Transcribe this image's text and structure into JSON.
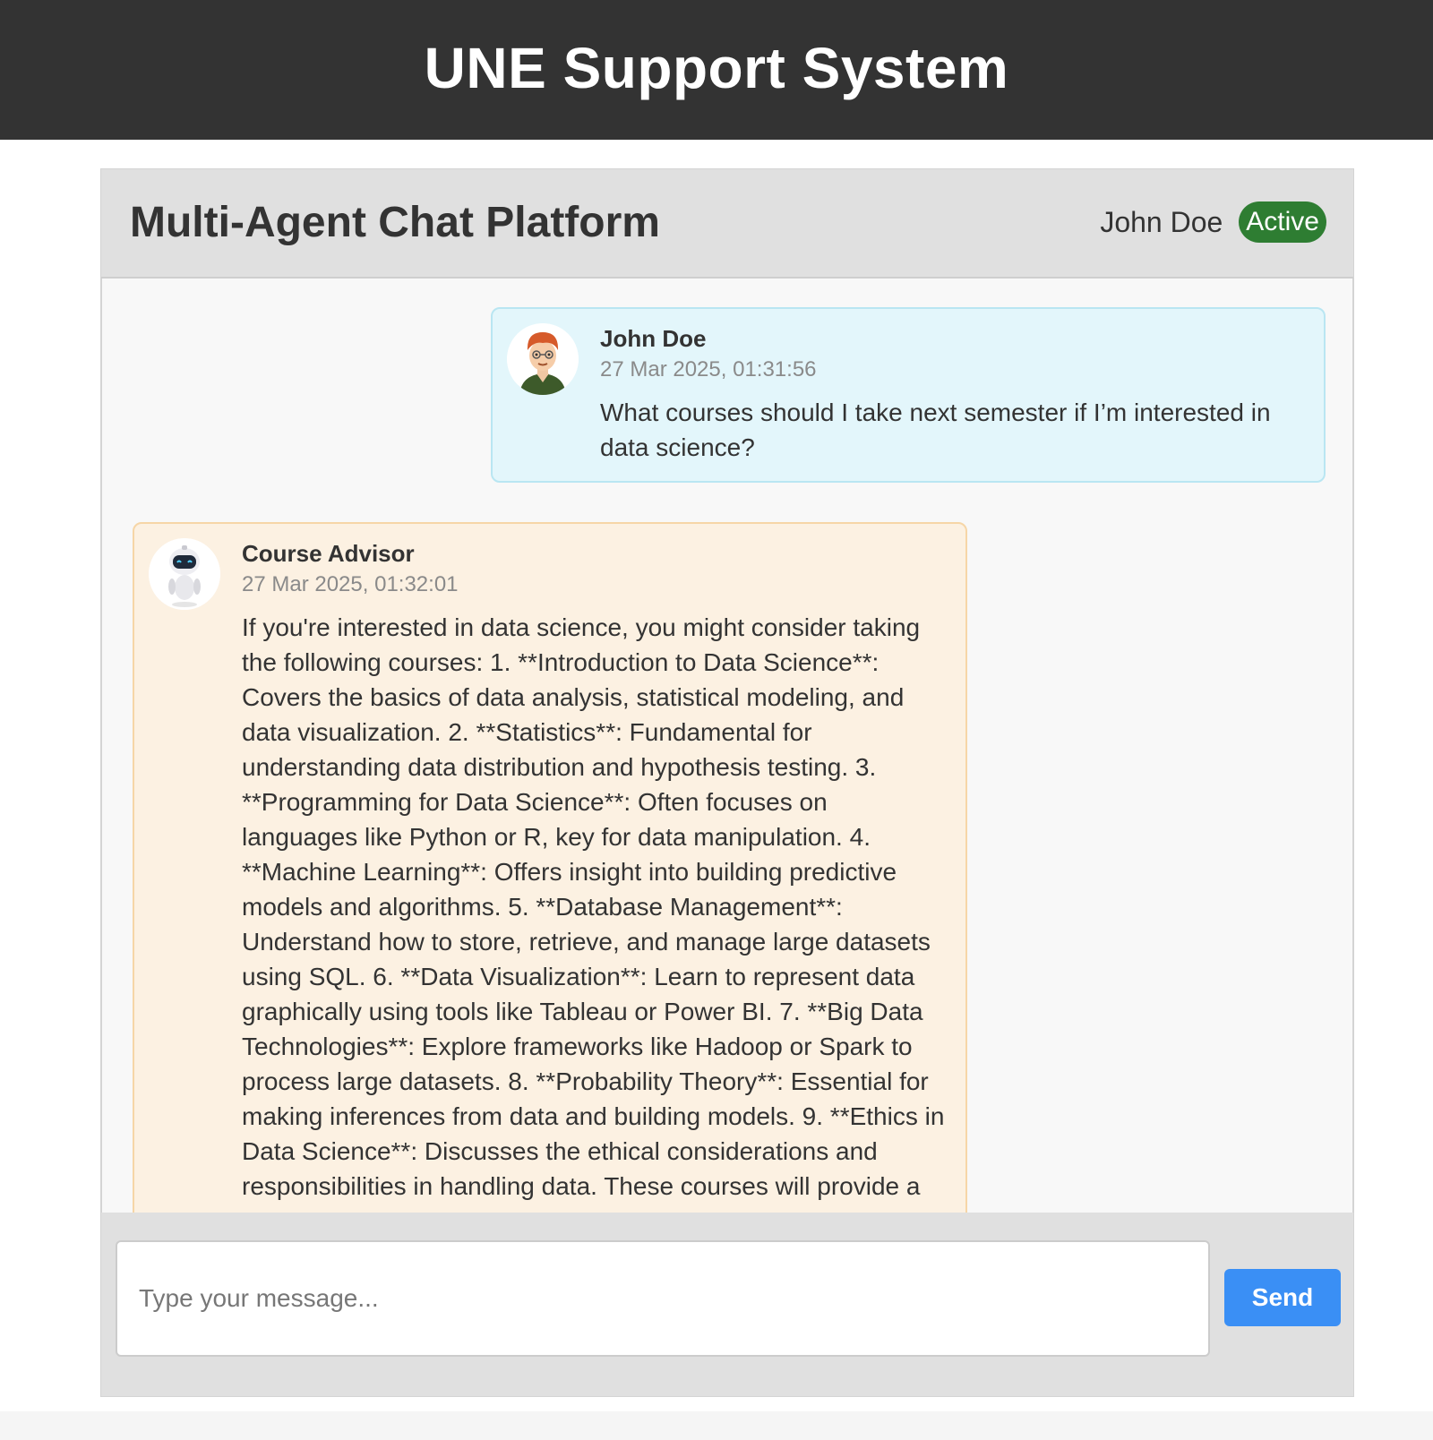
{
  "app": {
    "title": "UNE Support System"
  },
  "chat": {
    "title": "Multi-Agent Chat Platform",
    "user_name": "John Doe",
    "status": "Active"
  },
  "messages": [
    {
      "sender": "John Doe",
      "timestamp": "27 Mar 2025, 01:31:56",
      "text": "What courses should I take next semester if I’m interested in data science?",
      "avatar": "user-avatar-icon"
    },
    {
      "sender": "Course Advisor",
      "timestamp": "27 Mar 2025, 01:32:01",
      "text": "If you're interested in data science, you might consider taking the following courses: 1. **Introduction to Data Science**: Covers the basics of data analysis, statistical modeling, and data visualization. 2. **Statistics**: Fundamental for understanding data distribution and hypothesis testing. 3. **Programming for Data Science**: Often focuses on languages like Python or R, key for data manipulation. 4. **Machine Learning**: Offers insight into building predictive models and algorithms. 5. **Database Management**: Understand how to store, retrieve, and manage large datasets using SQL. 6. **Data Visualization**: Learn to represent data graphically using tools like Tableau or Power BI. 7. **Big Data Technologies**: Explore frameworks like Hadoop or Spark to process large datasets. 8. **Probability Theory**: Essential for making inferences from data and building models. 9. **Ethics in Data Science**: Discusses the ethical considerations and responsibilities in handling data. These courses will provide a",
      "avatar": "robot-avatar-icon"
    }
  ],
  "composer": {
    "placeholder": "Type your message...",
    "send_label": "Send"
  },
  "colors": {
    "header_bg": "#333333",
    "status_active": "#2e7d32",
    "send_button": "#3a8ff5",
    "user_bubble": "#e3f6fb",
    "agent_bubble": "#fcf1e2"
  }
}
